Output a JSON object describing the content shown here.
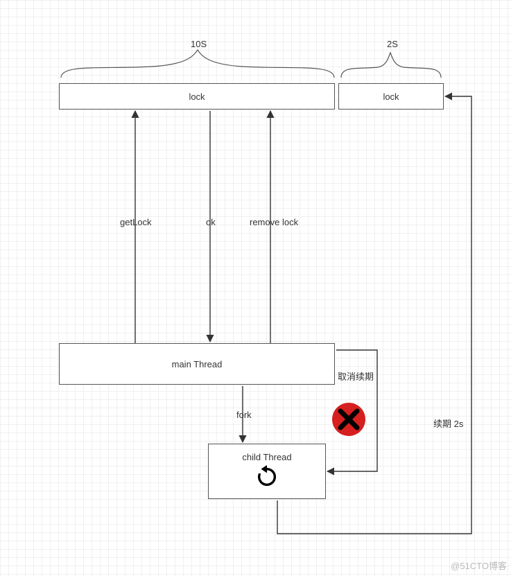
{
  "time_labels": {
    "ten_s": "10S",
    "two_s": "2S"
  },
  "boxes": {
    "lock_left": "lock",
    "lock_right": "lock",
    "main_thread": "main Thread",
    "child_thread": "child Thread"
  },
  "edges": {
    "get_lock": "getLock",
    "ok": "ok",
    "remove_lock": "remove lock",
    "fork": "fork",
    "cancel_renew": "取消续期",
    "renew_2s": "续期 2s"
  },
  "icons": {
    "cancel": "cancel-icon",
    "refresh": "refresh-icon"
  },
  "watermark": "@51CTO博客"
}
